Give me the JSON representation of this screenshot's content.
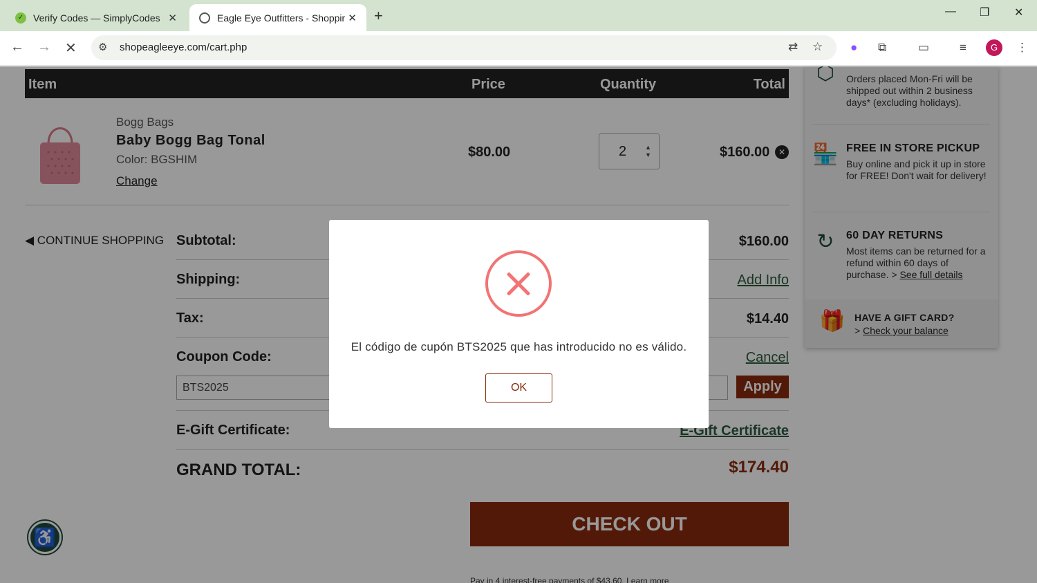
{
  "browser": {
    "tabs": [
      {
        "title": "Verify Codes — SimplyCodes",
        "active": false
      },
      {
        "title": "Eagle Eye Outfitters - Shopping",
        "active": true
      }
    ],
    "url": "shopeagleeye.com/cart.php",
    "profile_initial": "G"
  },
  "cart": {
    "headers": {
      "item": "Item",
      "price": "Price",
      "quantity": "Quantity",
      "total": "Total"
    },
    "item": {
      "brand": "Bogg Bags",
      "name": "Baby Bogg Bag Tonal",
      "color": "Color: BGSHIM",
      "change_label": "Change",
      "price": "$80.00",
      "quantity": "2",
      "total": "$160.00"
    },
    "continue_label": "CONTINUE SHOPPING",
    "summary": {
      "subtotal_label": "Subtotal:",
      "subtotal_value": "$160.00",
      "shipping_label": "Shipping:",
      "shipping_link": "Add Info",
      "tax_label": "Tax:",
      "tax_value": "$14.40",
      "coupon_label": "Coupon Code:",
      "coupon_cancel": "Cancel",
      "coupon_value": "BTS2025",
      "apply_label": "Apply",
      "gift_label": "E-Gift Certificate:",
      "gift_link": "E-Gift Certificate",
      "grand_label": "GRAND TOTAL:",
      "grand_value": "$174.40"
    },
    "checkout_label": "CHECK OUT",
    "paypal_text": "Pay in 4 interest-free payments of $43.60. Learn more"
  },
  "sidebar": {
    "shipping_text": "Orders placed Mon-Fri will be shipped out within 2 business days* (excluding holidays).",
    "pickup_title": "FREE IN STORE PICKUP",
    "pickup_text": "Buy online and pick it up in store for FREE! Don't wait for delivery!",
    "returns_title": "60 DAY RETURNS",
    "returns_text": "Most items can be returned for a refund within 60 days of purchase. >",
    "returns_link": "See full details",
    "gift_title": "HAVE A GIFT CARD?",
    "gift_link": "Check your balance"
  },
  "modal": {
    "message": "El código de cupón BTS2025 que has introducido no es válido.",
    "ok_label": "OK"
  },
  "colors": {
    "brand": "#8b2a0e",
    "accent_green": "#1e4a3a",
    "error": "#f27474"
  }
}
